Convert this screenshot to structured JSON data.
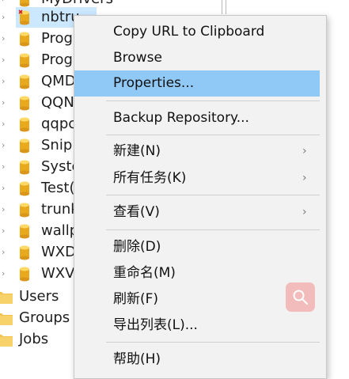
{
  "tree": {
    "partial_top_label": "MyDrivers",
    "repositories": [
      {
        "label": "nbtru",
        "selected": true
      },
      {
        "label": "Prog"
      },
      {
        "label": "Prog"
      },
      {
        "label": "QMD"
      },
      {
        "label": "QQN"
      },
      {
        "label": "qqpc"
      },
      {
        "label": "Snip"
      },
      {
        "label": "Syste"
      },
      {
        "label": "Test("
      },
      {
        "label": "trunk"
      },
      {
        "label": "wallp"
      },
      {
        "label": "WXD"
      },
      {
        "label": "WXV"
      }
    ],
    "groups": [
      {
        "label": "Users"
      },
      {
        "label": "Groups"
      },
      {
        "label": "Jobs"
      }
    ]
  },
  "context_menu": {
    "items": [
      {
        "label": "Copy URL to Clipboard"
      },
      {
        "label": "Browse"
      },
      {
        "label": "Properties...",
        "highlighted": true
      },
      {
        "label": "Backup Repository..."
      },
      {
        "label": "新建(N)",
        "submenu": true
      },
      {
        "label": "所有任务(K)",
        "submenu": true
      },
      {
        "label": "查看(V)",
        "submenu": true
      },
      {
        "label": "删除(D)"
      },
      {
        "label": "重命名(M)"
      },
      {
        "label": "刷新(F)"
      },
      {
        "label": "导出列表(L)..."
      },
      {
        "label": "帮助(H)"
      }
    ],
    "submenu_arrow": "›",
    "highlight_color": "#90c8f6"
  },
  "icons": {
    "chevron": "›",
    "repository": "database-icon",
    "group": "folder-icon",
    "floating_search": "search-icon"
  },
  "colors": {
    "selection": "#cce8ff",
    "floating_search_bg": "#f4b3b3"
  }
}
